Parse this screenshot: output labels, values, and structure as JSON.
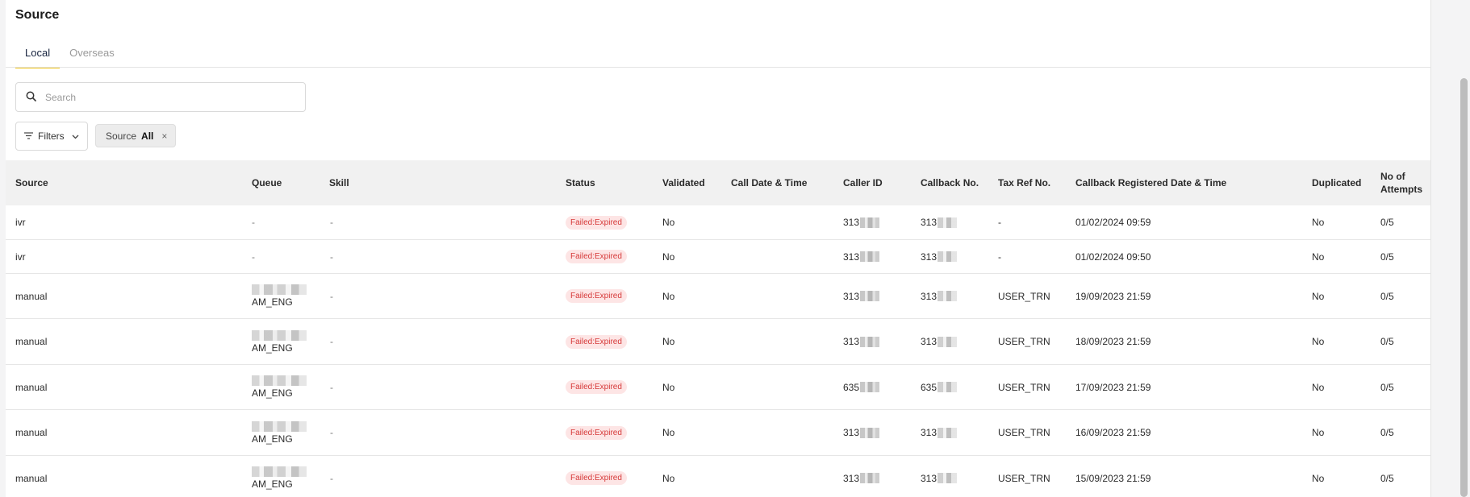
{
  "page": {
    "title": "Source"
  },
  "tabs": [
    {
      "label": "Local",
      "active": true
    },
    {
      "label": "Overseas",
      "active": false
    }
  ],
  "search": {
    "placeholder": "Search",
    "icon": "search-icon"
  },
  "filters": {
    "button_label": "Filters",
    "chip": {
      "label": "Source",
      "value": "All",
      "close": "×"
    }
  },
  "colors": {
    "accent": "#f0c419",
    "status_bg": "#fde5e5",
    "status_text": "#d63a3a",
    "header_bg": "#f1f1f1"
  },
  "table": {
    "headers": {
      "source": "Source",
      "queue": "Queue",
      "skill": "Skill",
      "status": "Status",
      "validated": "Validated",
      "call_date": "Call Date & Time",
      "caller_id": "Caller ID",
      "callback_no": "Callback No.",
      "tax_ref": "Tax Ref No.",
      "registered": "Callback Registered Date & Time",
      "duplicated": "Duplicated",
      "attempts": "No of Attempts"
    },
    "rows": [
      {
        "source": "ivr",
        "queue": "-",
        "skill": "-",
        "status": "Failed:Expired",
        "validated": "No",
        "call_date": "",
        "caller_id": "313",
        "callback_no": "313",
        "tax_ref": "-",
        "registered": "01/02/2024 09:59",
        "duplicated": "No",
        "attempts": "0/5"
      },
      {
        "source": "ivr",
        "queue": "-",
        "skill": "-",
        "status": "Failed:Expired",
        "validated": "No",
        "call_date": "",
        "caller_id": "313",
        "callback_no": "313",
        "tax_ref": "-",
        "registered": "01/02/2024 09:50",
        "duplicated": "No",
        "attempts": "0/5"
      },
      {
        "source": "manual",
        "queue": "AM_ENG",
        "skill": "-",
        "status": "Failed:Expired",
        "validated": "No",
        "call_date": "",
        "caller_id": "313",
        "callback_no": "313",
        "tax_ref": "USER_TRN",
        "registered": "19/09/2023 21:59",
        "duplicated": "No",
        "attempts": "0/5"
      },
      {
        "source": "manual",
        "queue": "AM_ENG",
        "skill": "-",
        "status": "Failed:Expired",
        "validated": "No",
        "call_date": "",
        "caller_id": "313",
        "callback_no": "313",
        "tax_ref": "USER_TRN",
        "registered": "18/09/2023 21:59",
        "duplicated": "No",
        "attempts": "0/5"
      },
      {
        "source": "manual",
        "queue": "AM_ENG",
        "skill": "-",
        "status": "Failed:Expired",
        "validated": "No",
        "call_date": "",
        "caller_id": "635",
        "callback_no": "635",
        "tax_ref": "USER_TRN",
        "registered": "17/09/2023 21:59",
        "duplicated": "No",
        "attempts": "0/5"
      },
      {
        "source": "manual",
        "queue": "AM_ENG",
        "skill": "-",
        "status": "Failed:Expired",
        "validated": "No",
        "call_date": "",
        "caller_id": "313",
        "callback_no": "313",
        "tax_ref": "USER_TRN",
        "registered": "16/09/2023 21:59",
        "duplicated": "No",
        "attempts": "0/5"
      },
      {
        "source": "manual",
        "queue": "AM_ENG",
        "skill": "-",
        "status": "Failed:Expired",
        "validated": "No",
        "call_date": "",
        "caller_id": "313",
        "callback_no": "313",
        "tax_ref": "USER_TRN",
        "registered": "15/09/2023 21:59",
        "duplicated": "No",
        "attempts": "0/5"
      }
    ]
  }
}
